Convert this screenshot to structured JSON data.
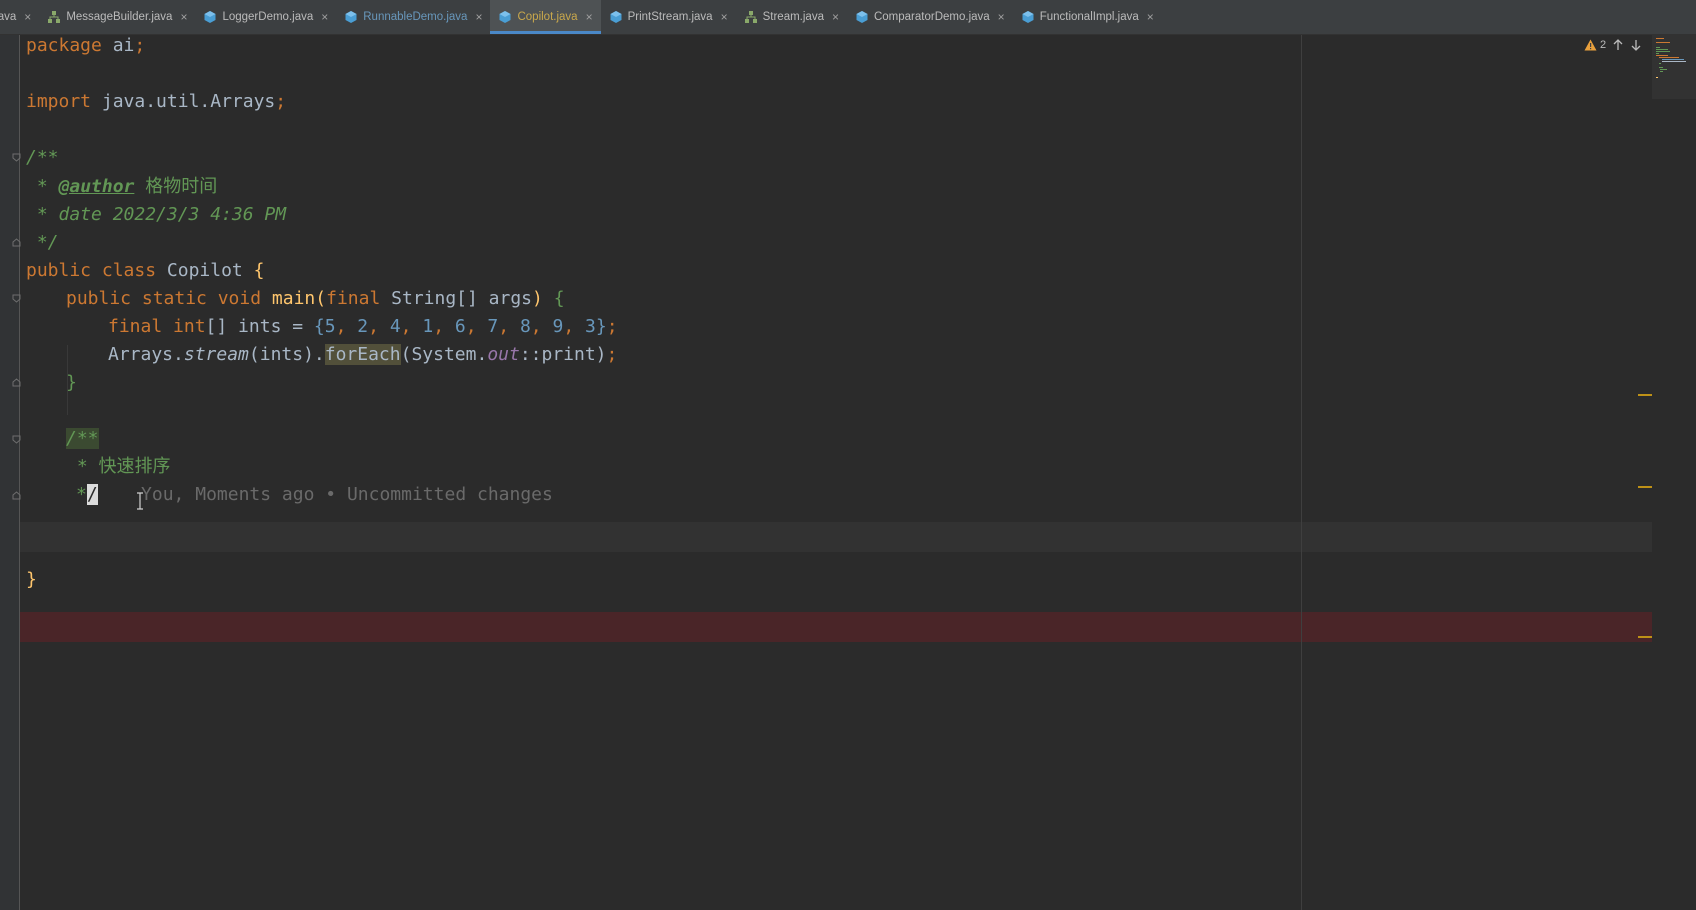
{
  "tabs": [
    {
      "label": ".java",
      "icon": "java-class-icon",
      "color": "default",
      "active": false
    },
    {
      "label": "MessageBuilder.java",
      "icon": "java-structure-icon",
      "color": "default",
      "active": false
    },
    {
      "label": "LoggerDemo.java",
      "icon": "java-class-icon",
      "color": "default",
      "active": false
    },
    {
      "label": "RunnableDemo.java",
      "icon": "java-class-icon",
      "color": "blue",
      "active": false
    },
    {
      "label": "Copilot.java",
      "icon": "java-class-icon",
      "color": "gold",
      "active": true
    },
    {
      "label": "PrintStream.java",
      "icon": "java-class-icon",
      "color": "default",
      "active": false
    },
    {
      "label": "Stream.java",
      "icon": "java-structure-icon",
      "color": "default",
      "active": false
    },
    {
      "label": "ComparatorDemo.java",
      "icon": "java-class-icon",
      "color": "default",
      "active": false
    },
    {
      "label": "FunctionalImpl.java",
      "icon": "java-class-icon",
      "color": "default",
      "active": false
    }
  ],
  "tab_close_glyph": "×",
  "inspection": {
    "warning_count": "2"
  },
  "code": {
    "l1_kw": "package",
    "l1_rest": " ai",
    "l1_semi": ";",
    "l2_kw": "import",
    "l2_rest": " java.util.Arrays",
    "l2_semi": ";",
    "l3": "/**",
    "l4_pre": " * ",
    "l4_tag": "@author",
    "l4_rest": " 格物时间",
    "l5": " * date 2022/3/3 4:36 PM",
    "l6": " */",
    "l7_kw": "public class ",
    "l7_name": "Copilot ",
    "l7_brace": "{",
    "l8_kw": "public static void ",
    "l8_fn": "main",
    "l8_p1": "(",
    "l8_kw2": "final ",
    "l8_rest": "String[] args",
    "l8_p2": ") ",
    "l8_brace": "{",
    "l9_kw": "final int",
    "l9_rest": "[] ints = ",
    "l9_values": [
      "5",
      "2",
      "4",
      "1",
      "6",
      "7",
      "8",
      "9",
      "3"
    ],
    "l9_open": "{",
    "l9_close": "}",
    "l9_semi": ";",
    "l9_sep": ", ",
    "l10_a": "Arrays.",
    "l10_stream": "stream",
    "l10_b": "(ints).",
    "l10_foreach": "forEach",
    "l10_c": "(System.",
    "l10_out": "out",
    "l10_d": "::print)",
    "l10_semi": ";",
    "l11": "}",
    "l12": "/**",
    "l13": " * 快速排序",
    "l14_star": "*",
    "l14_slash": "/",
    "l14_blame": "You, Moments ago • Uncommitted changes",
    "l15": "}"
  }
}
